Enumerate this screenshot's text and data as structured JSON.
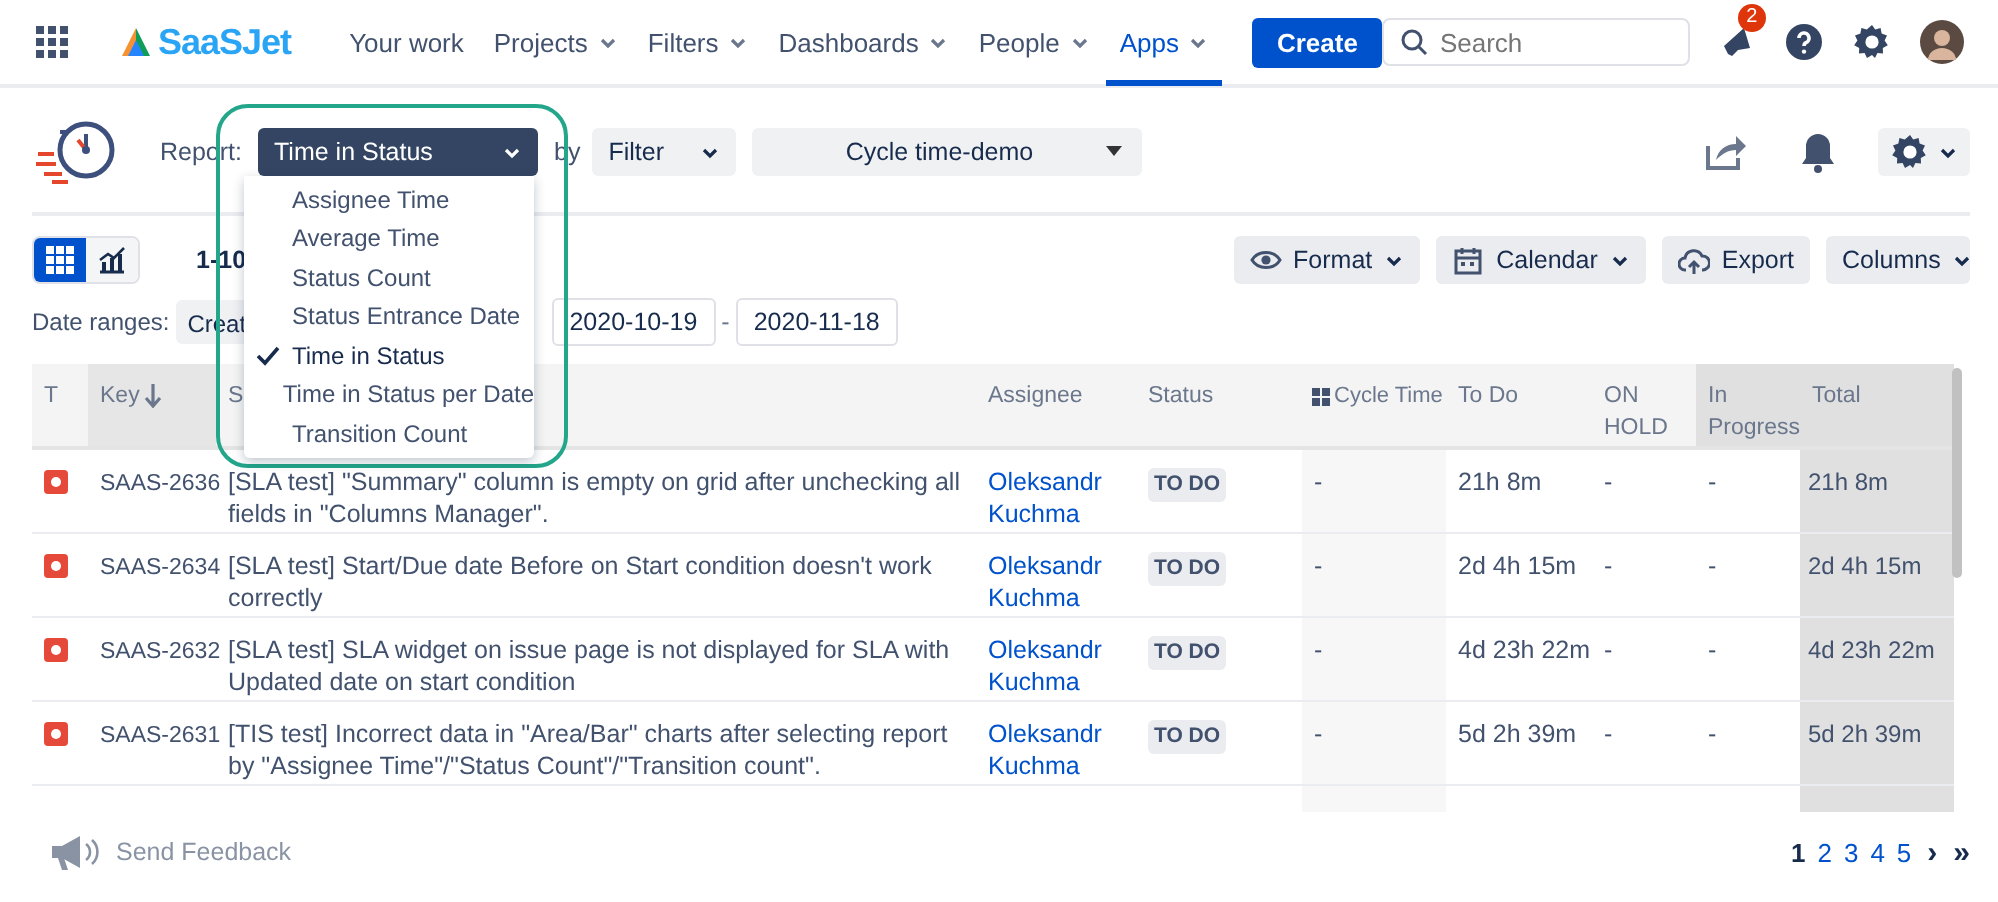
{
  "nav": {
    "brand": "SaaSJet",
    "items": [
      {
        "label": "Your work",
        "dropdown": false,
        "selected": false
      },
      {
        "label": "Projects",
        "dropdown": true,
        "selected": false
      },
      {
        "label": "Filters",
        "dropdown": true,
        "selected": false
      },
      {
        "label": "Dashboards",
        "dropdown": true,
        "selected": false
      },
      {
        "label": "People",
        "dropdown": true,
        "selected": false
      },
      {
        "label": "Apps",
        "dropdown": true,
        "selected": true
      }
    ],
    "create": "Create",
    "search": {
      "placeholder": "Search"
    },
    "notification_count": "2"
  },
  "report": {
    "label": "Report:",
    "value": "Time in Status",
    "by": "by",
    "group": "Filter",
    "filter": "Cycle time-demo"
  },
  "report_menu": [
    {
      "label": "Assignee Time",
      "selected": false
    },
    {
      "label": "Average Time",
      "selected": false
    },
    {
      "label": "Status Count",
      "selected": false
    },
    {
      "label": "Status Entrance Date",
      "selected": false
    },
    {
      "label": "Time in Status",
      "selected": true
    },
    {
      "label": "Time in Status per Date",
      "selected": false
    },
    {
      "label": "Transition Count",
      "selected": false
    }
  ],
  "view_toggle": [
    {
      "kind": "grid",
      "selected": true
    },
    {
      "kind": "chart",
      "selected": false
    }
  ],
  "range": "1-10",
  "toolbar": [
    {
      "label": "Format",
      "dropdown": true
    },
    {
      "label": "Calendar",
      "dropdown": true
    },
    {
      "label": "Export",
      "dropdown": false
    },
    {
      "label": "Columns",
      "dropdown": true
    }
  ],
  "date_ranges": {
    "label": "Date ranges:",
    "field": "Creat",
    "from": "2020-10-19",
    "to": "2020-11-18",
    "separator": "-"
  },
  "table": {
    "columns": [
      {
        "label": "T",
        "kind": "type"
      },
      {
        "label": "Key",
        "kind": "key"
      },
      {
        "label": "S",
        "kind": "summary"
      },
      {
        "label": "Assignee",
        "kind": "plain"
      },
      {
        "label": "Status",
        "kind": "plain"
      },
      {
        "label": "Cycle Time",
        "kind": "cycle"
      },
      {
        "label": "To Do",
        "kind": "plain"
      },
      {
        "label": "ON HOLD",
        "kind": "plain"
      },
      {
        "label": "In Progress",
        "kind": "shaded"
      },
      {
        "label": "Total",
        "kind": "shaded"
      }
    ],
    "rows": [
      {
        "key": "SAAS-2636",
        "summary": "[SLA test] \"Summary\" column is empty on grid after unchecking all fields in \"Columns Manager\".",
        "assignee": "Oleksandr Kuchma",
        "status": "TO DO",
        "cycle_time": "-",
        "to_do": "21h 8m",
        "on_hold": "-",
        "in_progress": "-",
        "total": "21h 8m"
      },
      {
        "key": "SAAS-2634",
        "summary": "[SLA test] Start/Due date Before on Start condition doesn't work correctly",
        "assignee": "Oleksandr Kuchma",
        "status": "TO DO",
        "cycle_time": "-",
        "to_do": "2d 4h 15m",
        "on_hold": "-",
        "in_progress": "-",
        "total": "2d 4h 15m"
      },
      {
        "key": "SAAS-2632",
        "summary": "[SLA test] SLA widget on issue page is not displayed for SLA with Updated date on start condition",
        "assignee": "Oleksandr Kuchma",
        "status": "TO DO",
        "cycle_time": "-",
        "to_do": "4d 23h 22m",
        "on_hold": "-",
        "in_progress": "-",
        "total": "4d 23h 22m"
      },
      {
        "key": "SAAS-2631",
        "summary": "[TIS test] Incorrect data in \"Area/Bar\" charts after selecting report by \"Assignee Time\"/\"Status Count\"/\"Transition count\".",
        "assignee": "Oleksandr Kuchma",
        "status": "TO DO",
        "cycle_time": "-",
        "to_do": "5d 2h 39m",
        "on_hold": "-",
        "in_progress": "-",
        "total": "5d 2h 39m"
      }
    ]
  },
  "feedback": "Send Feedback",
  "pagination": [
    {
      "label": "1",
      "selected": true
    },
    {
      "label": "2",
      "selected": false
    },
    {
      "label": "3",
      "selected": false
    },
    {
      "label": "4",
      "selected": false
    },
    {
      "label": "5",
      "selected": false
    }
  ],
  "pager_next": "›",
  "pager_last": "»"
}
